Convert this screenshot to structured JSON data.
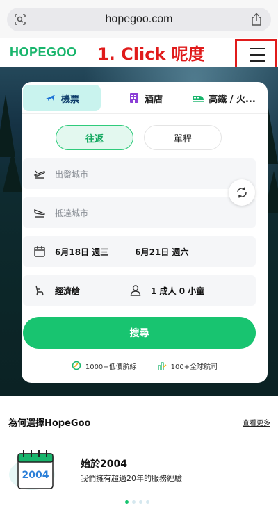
{
  "browser": {
    "url": "hopegoo.com",
    "left_icon": "page-search-icon",
    "right_icon": "share-icon"
  },
  "header": {
    "logo": "HOPEGOO",
    "annotation": "1. Click 呢度",
    "menu_icon": "hamburger-menu-icon"
  },
  "search_card": {
    "tabs": [
      {
        "label": "機票",
        "icon": "plane-icon",
        "active": true
      },
      {
        "label": "酒店",
        "icon": "hotel-icon",
        "active": false
      },
      {
        "label": "高鐵 / 火...",
        "icon": "train-icon",
        "active": false
      }
    ],
    "trip_types": {
      "round": "往返",
      "one_way": "單程"
    },
    "departure_placeholder": "出發城市",
    "arrival_placeholder": "抵達城市",
    "depart_date": "6月18日 週三",
    "date_separator": "–",
    "return_date": "6月21日 週六",
    "cabin": "經濟艙",
    "passengers": "1 成人 0 小童",
    "search_label": "搜尋",
    "stat_left": "1000+低價航線",
    "stat_right": "100+全球航司"
  },
  "why": {
    "title": "為何選擇HopeGoo",
    "more": "查看更多",
    "features": [
      {
        "title": "始於2004",
        "desc": "我們擁有超過20年的服務經驗",
        "icon_text": "2004"
      }
    ]
  },
  "colors": {
    "brand_green": "#18c470",
    "annotation_red": "#e01b1b",
    "tab_active_bg": "#c9f3ee"
  }
}
